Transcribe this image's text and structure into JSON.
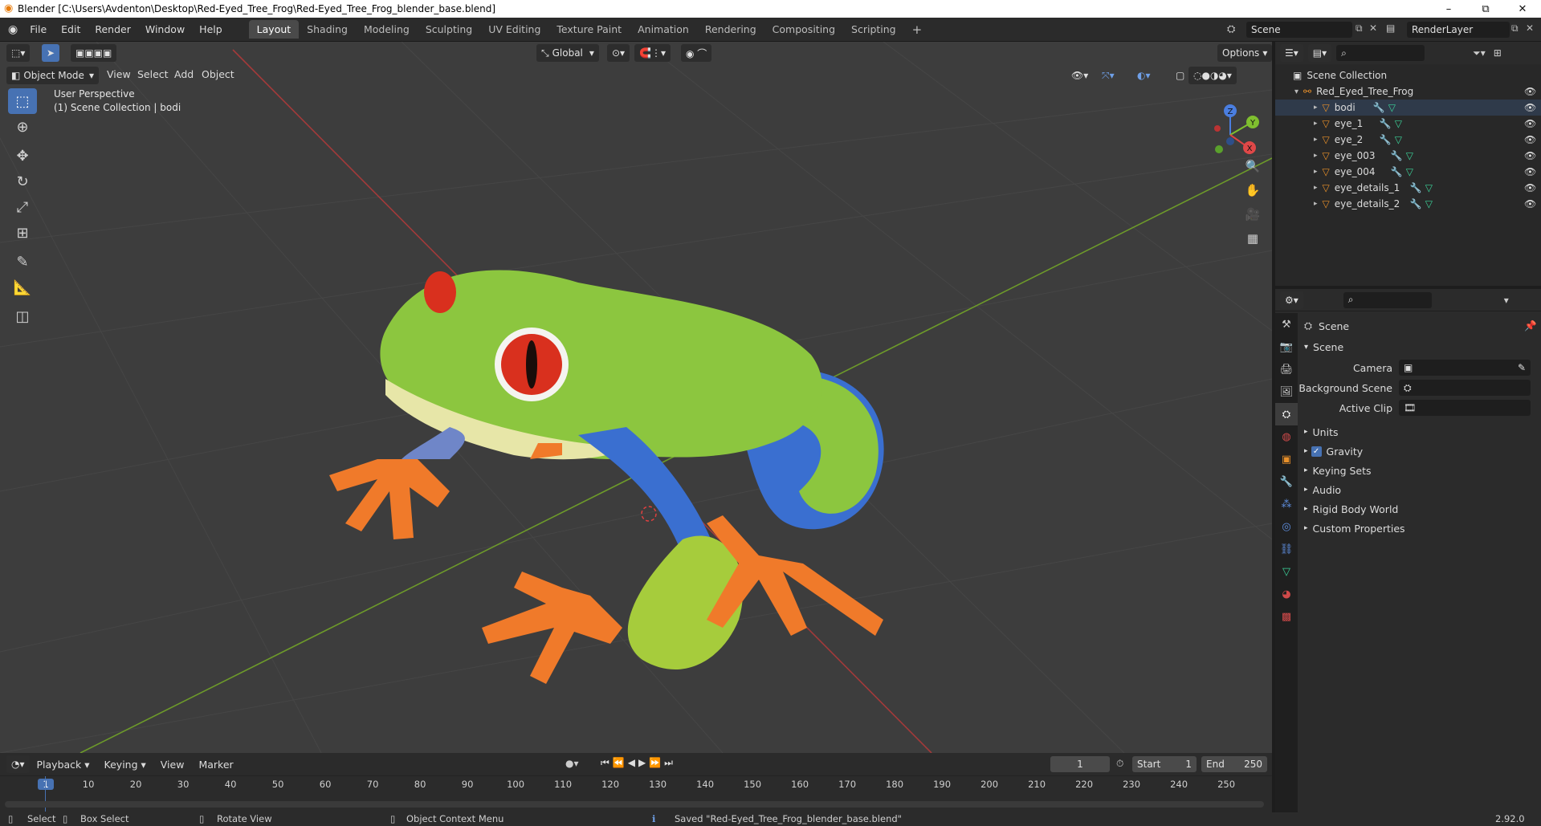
{
  "window": {
    "title": "Blender [C:\\Users\\Avdenton\\Desktop\\Red-Eyed_Tree_Frog\\Red-Eyed_Tree_Frog_blender_base.blend]",
    "minimize": "–",
    "maximize": "⧉",
    "close": "✕"
  },
  "menubar": {
    "menus": [
      "File",
      "Edit",
      "Render",
      "Window",
      "Help"
    ],
    "workspaces": [
      "Layout",
      "Shading",
      "Modeling",
      "Sculpting",
      "UV Editing",
      "Texture Paint",
      "Animation",
      "Rendering",
      "Compositing",
      "Scripting"
    ],
    "active_workspace": "Layout",
    "add_workspace": "+",
    "scene_name": "Scene",
    "view_layer": "RenderLayer"
  },
  "viewport": {
    "transform_orientation": "Global",
    "options_label": "Options",
    "mode": "Object Mode",
    "menus": [
      "View",
      "Select",
      "Add",
      "Object"
    ],
    "overlay_line1": "User Perspective",
    "overlay_line2": "(1) Scene Collection | bodi",
    "gizmo": {
      "z": "Z",
      "y": "Y",
      "x": "X"
    }
  },
  "outliner": {
    "root": "Scene Collection",
    "collection": "Red_Eyed_Tree_Frog",
    "objects": [
      "bodi",
      "eye_1",
      "eye_2",
      "eye_003",
      "eye_004",
      "eye_details_1",
      "eye_details_2"
    ]
  },
  "properties": {
    "context_title": "Scene",
    "panel_title": "Scene",
    "camera_label": "Camera",
    "background_scene_label": "Background Scene",
    "active_clip_label": "Active Clip",
    "subpanels": [
      "Units",
      "Gravity",
      "Keying Sets",
      "Audio",
      "Rigid Body World",
      "Custom Properties"
    ],
    "gravity_checked": true
  },
  "timeline": {
    "menus": [
      "Playback",
      "Keying",
      "View",
      "Marker"
    ],
    "current_frame": "1",
    "start_label": "Start",
    "start_value": "1",
    "end_label": "End",
    "end_value": "250",
    "ruler_ticks": [
      "1",
      "10",
      "20",
      "30",
      "40",
      "50",
      "60",
      "70",
      "80",
      "90",
      "100",
      "110",
      "120",
      "130",
      "140",
      "150",
      "160",
      "170",
      "180",
      "190",
      "200",
      "210",
      "220",
      "230",
      "240",
      "250"
    ]
  },
  "statusbar": {
    "select": "Select",
    "box_select": "Box Select",
    "rotate_view": "Rotate View",
    "context_menu": "Object Context Menu",
    "message": "Saved \"Red-Eyed_Tree_Frog_blender_base.blend\"",
    "version": "2.92.0"
  },
  "colors": {
    "accent": "#4772b3",
    "viewport_bg": "#3d3d3d",
    "x_axis": "#c0392b",
    "y_axis": "#7fbf2f",
    "frog_green": "#8cc63f",
    "frog_orange": "#f07a2a",
    "frog_blue": "#3a6fd0"
  }
}
